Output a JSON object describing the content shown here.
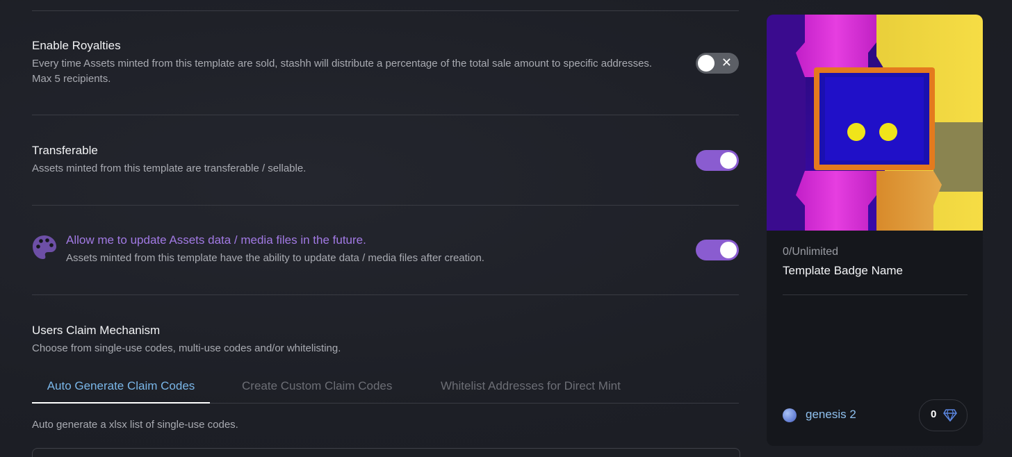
{
  "settings": {
    "royalties": {
      "title": "Enable Royalties",
      "description": "Every time Assets minted from this template are sold, stashh will distribute a percentage of the total sale amount to specific addresses. Max 5 recipients.",
      "enabled": false
    },
    "transferable": {
      "title": "Transferable",
      "description": "Assets minted from this template are transferable / sellable.",
      "enabled": true
    },
    "updatable": {
      "title": "Allow me to update Assets data / media files in the future.",
      "description": "Assets minted from this template have the ability to update data / media files after creation.",
      "enabled": true,
      "icon": "palette-icon"
    }
  },
  "claim": {
    "title": "Users Claim Mechanism",
    "description": "Choose from single-use codes, multi-use codes and/or whitelisting.",
    "tabs": [
      {
        "label": "Auto Generate Claim Codes",
        "active": true
      },
      {
        "label": "Create Custom Claim Codes",
        "active": false
      },
      {
        "label": "Whitelist Addresses for Direct Mint",
        "active": false
      }
    ],
    "tab_description": "Auto generate a xlsx list of single-use codes."
  },
  "card": {
    "count": "0/Unlimited",
    "name": "Template Badge Name",
    "chain": "genesis 2",
    "likes": "0",
    "icon": "gem-icon"
  },
  "colors": {
    "accent": "#8a5cd0",
    "link": "#7ab6e8",
    "background": "#1f2128",
    "card": "#15171c"
  }
}
